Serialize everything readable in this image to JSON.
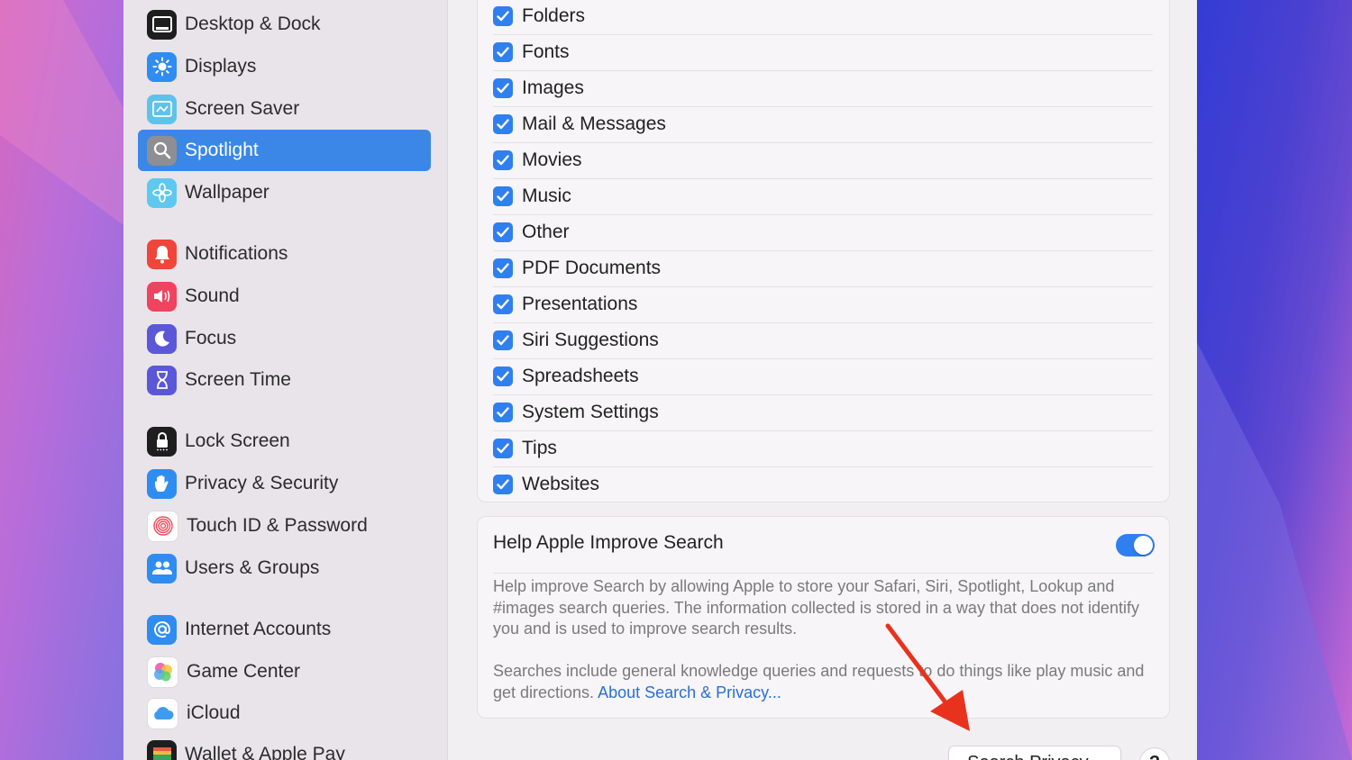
{
  "sidebar": {
    "items": [
      {
        "label": "Desktop & Dock",
        "icon": "desktop-dock-icon"
      },
      {
        "label": "Displays",
        "icon": "displays-icon"
      },
      {
        "label": "Screen Saver",
        "icon": "screen-saver-icon"
      },
      {
        "label": "Spotlight",
        "icon": "spotlight-icon",
        "selected": true
      },
      {
        "label": "Wallpaper",
        "icon": "wallpaper-icon"
      },
      {
        "label": "Notifications",
        "icon": "notifications-icon"
      },
      {
        "label": "Sound",
        "icon": "sound-icon"
      },
      {
        "label": "Focus",
        "icon": "focus-icon"
      },
      {
        "label": "Screen Time",
        "icon": "screen-time-icon"
      },
      {
        "label": "Lock Screen",
        "icon": "lock-screen-icon"
      },
      {
        "label": "Privacy & Security",
        "icon": "privacy-hand-icon"
      },
      {
        "label": "Touch ID & Password",
        "icon": "fingerprint-icon"
      },
      {
        "label": "Users & Groups",
        "icon": "users-groups-icon"
      },
      {
        "label": "Internet Accounts",
        "icon": "at-sign-icon"
      },
      {
        "label": "Game Center",
        "icon": "game-center-icon"
      },
      {
        "label": "iCloud",
        "icon": "icloud-icon"
      },
      {
        "label": "Wallet & Apple Pay",
        "icon": "wallet-icon"
      }
    ]
  },
  "categories": {
    "items": [
      {
        "label": "Folders",
        "checked": true
      },
      {
        "label": "Fonts",
        "checked": true
      },
      {
        "label": "Images",
        "checked": true
      },
      {
        "label": "Mail & Messages",
        "checked": true
      },
      {
        "label": "Movies",
        "checked": true
      },
      {
        "label": "Music",
        "checked": true
      },
      {
        "label": "Other",
        "checked": true
      },
      {
        "label": "PDF Documents",
        "checked": true
      },
      {
        "label": "Presentations",
        "checked": true
      },
      {
        "label": "Siri Suggestions",
        "checked": true
      },
      {
        "label": "Spreadsheets",
        "checked": true
      },
      {
        "label": "System Settings",
        "checked": true
      },
      {
        "label": "Tips",
        "checked": true
      },
      {
        "label": "Websites",
        "checked": true
      }
    ]
  },
  "help_card": {
    "title": "Help Apple Improve Search",
    "toggle_on": true,
    "paragraph1": "Help improve Search by allowing Apple to store your Safari, Siri, Spotlight, Lookup and #images search queries. The information collected is stored in a way that does not identify you and is used to improve search results.",
    "paragraph2": "Searches include general knowledge queries and requests to do things like play music and get directions.",
    "link": "About Search & Privacy..."
  },
  "footer": {
    "search_privacy_button": "Search Privacy...",
    "help_button": "?"
  },
  "colors": {
    "accent": "#2f7ff0",
    "selected_row": "#3a87e8",
    "annotation_arrow": "#e8321e"
  }
}
